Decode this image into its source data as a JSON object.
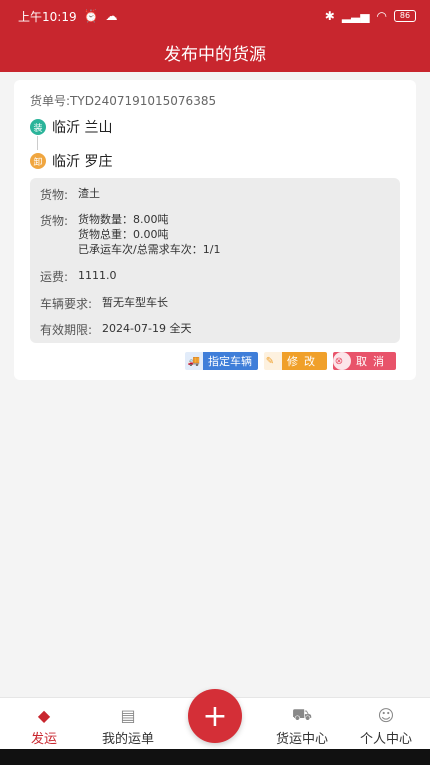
{
  "status_bar": {
    "time": "上午10:19",
    "battery": "86"
  },
  "header": {
    "title": "发布中的货源"
  },
  "order": {
    "order_number": "货单号:TYD2407191015076385",
    "origin_badge": "装",
    "origin": "临沂  兰山",
    "dest_badge": "卸",
    "destination": "临沂  罗庄",
    "cargo_label": "货物:",
    "cargo_value": "渣土",
    "cargo_detail_label": "货物:",
    "cargo_quantity": "货物数量：8.00吨",
    "cargo_weight": "货物总重：0.00吨",
    "trips": "已承运车次/总需求车次：1/1",
    "freight_label": "运费:",
    "freight_value": "1111.0",
    "vehicle_label": "车辆要求:",
    "vehicle_value": "暂无车型车长",
    "validity_label": "有效期限:",
    "validity_value": "2024-07-19  全天"
  },
  "actions": {
    "assign": "指定车辆",
    "edit": "修改",
    "cancel": "取消"
  },
  "tabs": {
    "ship": "发运",
    "my_waybills": "我的运单",
    "freight_center": "货运中心",
    "profile": "个人中心"
  },
  "colors": {
    "brand": "#c8262e",
    "assign": "#3f7ed9",
    "edit": "#f0a02a",
    "cancel": "#e8536a"
  }
}
